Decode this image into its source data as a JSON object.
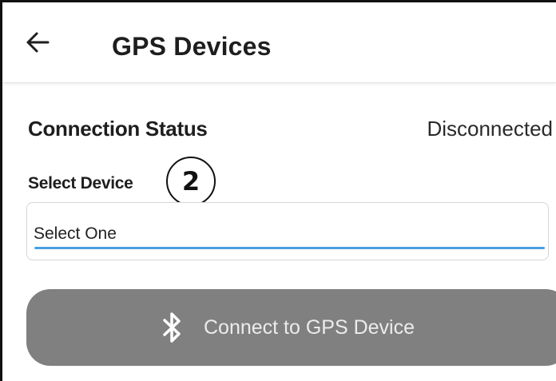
{
  "header": {
    "title": "GPS Devices",
    "back_icon": "arrow-left-icon"
  },
  "connection": {
    "label": "Connection Status",
    "value": "Disconnected"
  },
  "device_select": {
    "label": "Select Device",
    "step_badge": "2",
    "selected_value": "Select One",
    "underline_color": "#4aa0e0"
  },
  "connect_button": {
    "label": "Connect to GPS Device",
    "icon": "bluetooth-icon",
    "background": "#808080"
  }
}
